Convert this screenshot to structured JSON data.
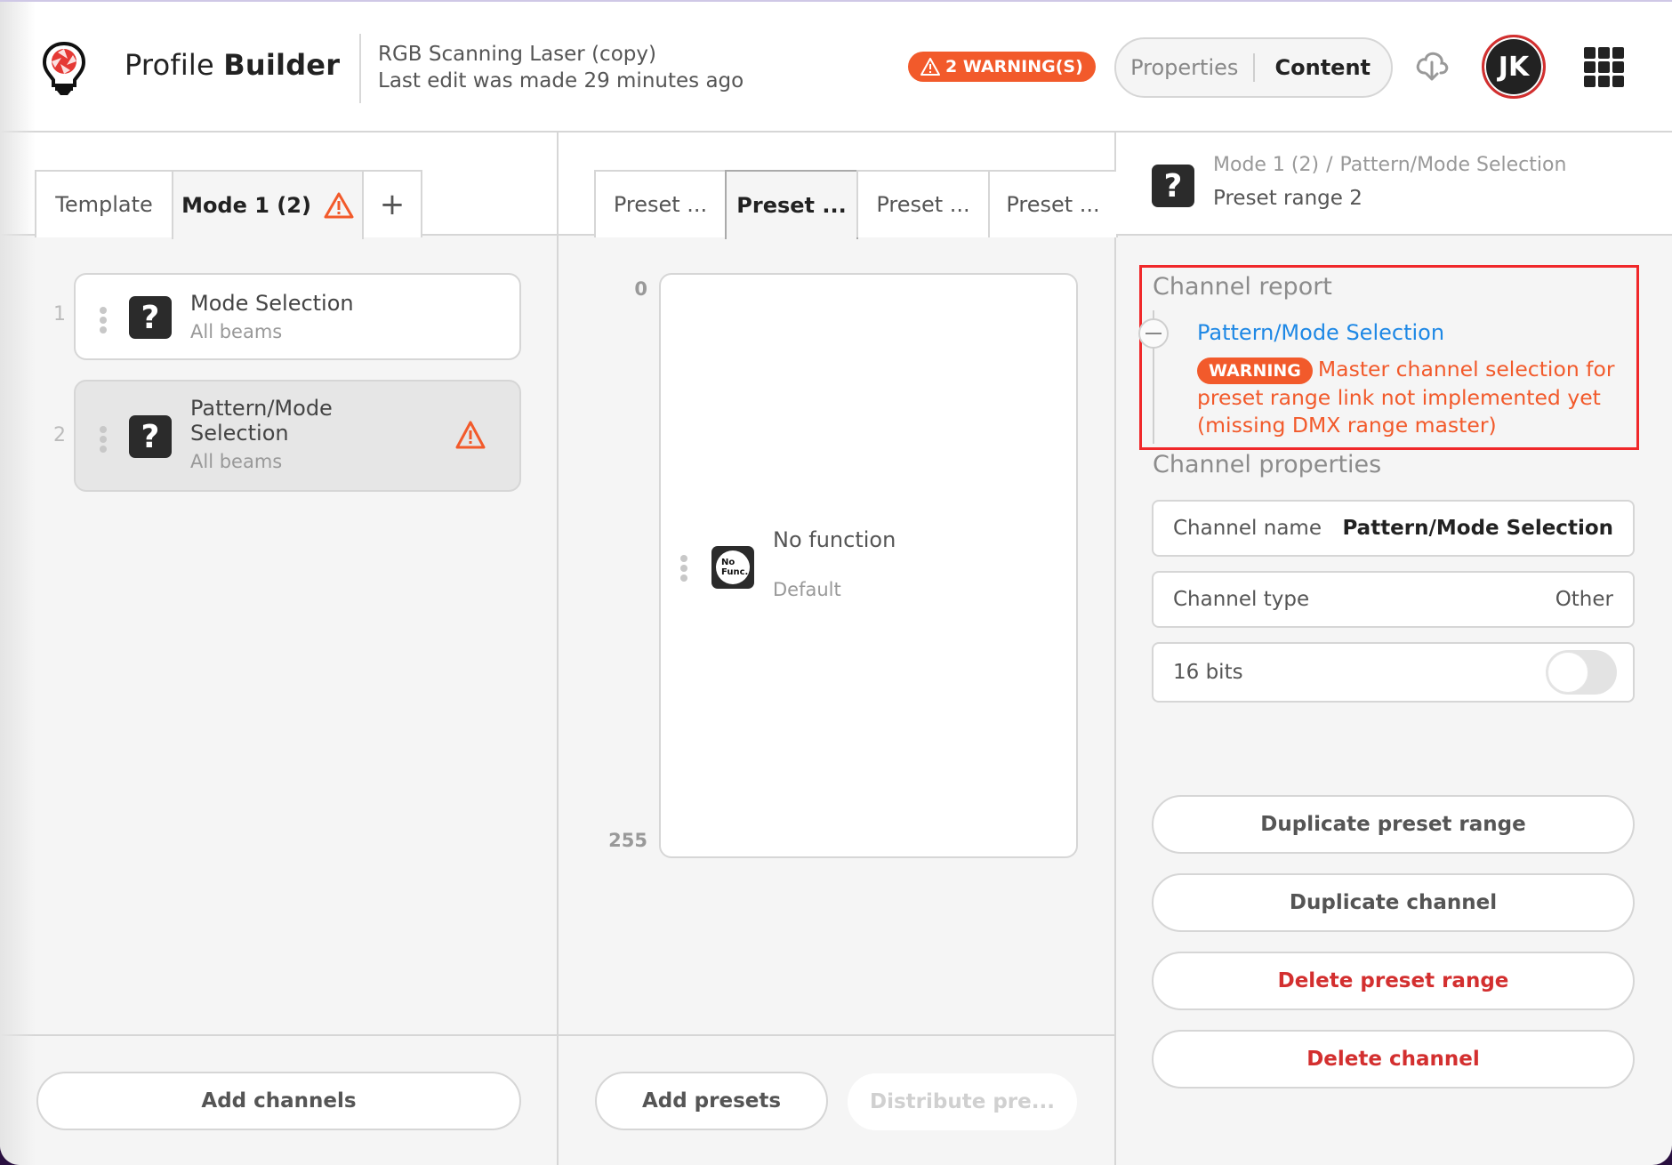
{
  "header": {
    "app_name_prefix": "Profile",
    "app_name_bold": "Builder",
    "document_title": "RGB Scanning Laser (copy)",
    "last_edit": "Last edit was made 29 minutes ago",
    "warnings_badge": "2 WARNING(S)",
    "view_toggle": {
      "options": [
        "Properties",
        "Content"
      ],
      "selected": "Content"
    },
    "avatar_initials": "JK",
    "icons": {
      "logo": "lightbulb-aperture-logo",
      "cloud": "cloud-download-icon",
      "apps": "apps-grid-icon"
    }
  },
  "left_panel": {
    "tabs": [
      {
        "label": "Template",
        "active": false
      },
      {
        "label": "Mode 1 (2)",
        "active": true,
        "warning": true
      }
    ],
    "add_tab_label": "+",
    "channels": [
      {
        "index": "1",
        "name": "Mode Selection",
        "sub": "All beams",
        "icon": "?",
        "selected": false,
        "warning": false
      },
      {
        "index": "2",
        "name": "Pattern/Mode Selection",
        "sub": "All beams",
        "icon": "?",
        "selected": true,
        "warning": true
      }
    ],
    "add_channels_label": "Add channels"
  },
  "middle_panel": {
    "tabs": [
      {
        "label": "Preset ...",
        "active": false
      },
      {
        "label": "Preset ...",
        "active": true
      },
      {
        "label": "Preset ...",
        "active": false
      },
      {
        "label": "Preset ...",
        "active": false
      }
    ],
    "range_start": "0",
    "range_end": "255",
    "preset": {
      "name": "No function",
      "sub": "Default",
      "icon_line1": "No",
      "icon_line2": "Func."
    },
    "add_presets_label": "Add presets",
    "distribute_label": "Distribute pre..."
  },
  "right_panel": {
    "breadcrumb": [
      "Mode 1 (2)",
      "Pattern/Mode Selection"
    ],
    "breadcrumb_sep": "/",
    "subtitle": "Preset range 2",
    "channel_report": {
      "label": "Channel report",
      "channel_link": "Pattern/Mode Selection",
      "severity": "WARNING",
      "message": "Master channel selection for preset range link not implemented yet (missing DMX range master)"
    },
    "channel_properties": {
      "label": "Channel properties",
      "name_label": "Channel name",
      "name_value": "Pattern/Mode Selection",
      "type_label": "Channel type",
      "type_value": "Other",
      "bits_label": "16 bits",
      "bits_enabled": false
    },
    "actions": {
      "duplicate_preset_range": "Duplicate preset range",
      "duplicate_channel": "Duplicate channel",
      "delete_preset_range": "Delete preset range",
      "delete_channel": "Delete channel"
    }
  },
  "colors": {
    "warning": "#f25a2b",
    "danger": "#d32f2f",
    "link": "#1e88e5",
    "highlight_box": "#f0282a"
  }
}
